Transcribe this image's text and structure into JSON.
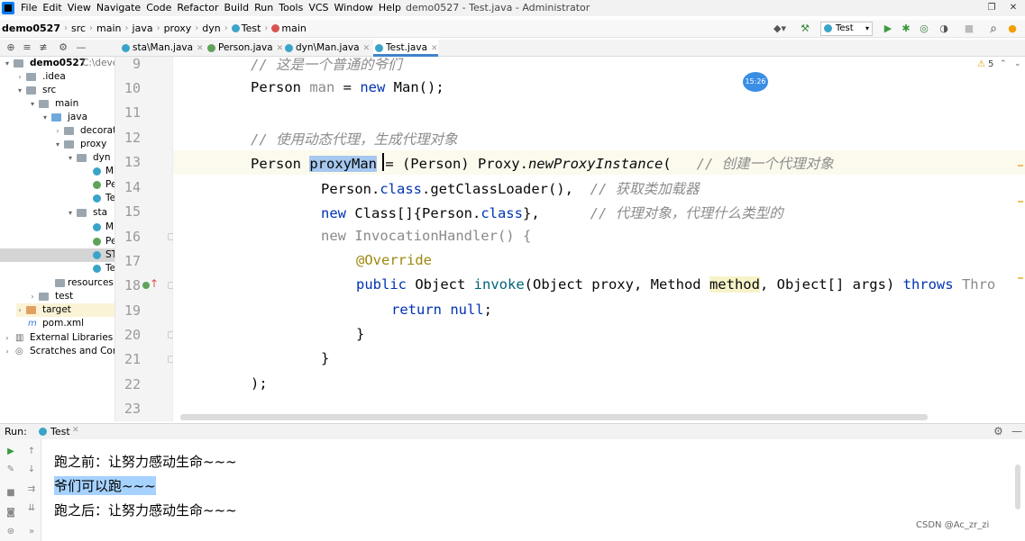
{
  "window": {
    "title": "demo0527 - Test.java - Administrator",
    "menus": [
      "File",
      "Edit",
      "View",
      "Navigate",
      "Code",
      "Refactor",
      "Build",
      "Run",
      "Tools",
      "VCS",
      "Window",
      "Help"
    ],
    "restore_glyph": "❐",
    "close_glyph": "✕"
  },
  "breadcrumb": [
    "demo0527",
    "src",
    "main",
    "java",
    "proxy",
    "dyn",
    "Test",
    "main"
  ],
  "toolbar": {
    "run_config": "Test",
    "warning_count": "5",
    "glyphs": {
      "build": "⚒",
      "run": "▶",
      "debug": "✱",
      "coverage": "◎",
      "profile": "◑",
      "stop": "■",
      "search": "⌕",
      "update": "●",
      "nav": "◆▾"
    }
  },
  "tabs": [
    {
      "label": "sta\\Man.java",
      "icon": "class"
    },
    {
      "label": "Person.java",
      "icon": "interface"
    },
    {
      "label": "dyn\\Man.java",
      "icon": "class"
    },
    {
      "label": "Test.java",
      "icon": "class",
      "active": true
    }
  ],
  "project_tools": [
    "⊕",
    "≡",
    "≢",
    "⚙",
    "—"
  ],
  "tree": [
    {
      "label": "demo0527",
      "path": "C:\\devel",
      "depth": 0,
      "arrow": "▾",
      "icon": "folder"
    },
    {
      "label": ".idea",
      "depth": 1,
      "arrow": "›",
      "icon": "folder"
    },
    {
      "label": "src",
      "depth": 1,
      "arrow": "▾",
      "icon": "folder"
    },
    {
      "label": "main",
      "depth": 2,
      "arrow": "▾",
      "icon": "folder"
    },
    {
      "label": "java",
      "depth": 3,
      "arrow": "▾",
      "icon": "folder-blue"
    },
    {
      "label": "decorato",
      "depth": 4,
      "arrow": "›",
      "icon": "folder"
    },
    {
      "label": "proxy",
      "depth": 4,
      "arrow": "▾",
      "icon": "folder"
    },
    {
      "label": "dyn",
      "depth": 5,
      "arrow": "▾",
      "icon": "folder"
    },
    {
      "label": "M",
      "depth": 6,
      "arrow": "",
      "icon": "class"
    },
    {
      "label": "Pe",
      "depth": 6,
      "arrow": "",
      "icon": "interface"
    },
    {
      "label": "Te",
      "depth": 6,
      "arrow": "",
      "icon": "class"
    },
    {
      "label": "sta",
      "depth": 5,
      "arrow": "▾",
      "icon": "folder"
    },
    {
      "label": "M",
      "depth": 6,
      "arrow": "",
      "icon": "class"
    },
    {
      "label": "Pe",
      "depth": 6,
      "arrow": "",
      "icon": "interface"
    },
    {
      "label": "ST",
      "depth": 6,
      "arrow": "",
      "icon": "class",
      "selected": true
    },
    {
      "label": "Te",
      "depth": 6,
      "arrow": "",
      "icon": "class"
    },
    {
      "label": "resources",
      "depth": 3,
      "arrow": "",
      "icon": "folder"
    },
    {
      "label": "test",
      "depth": 2,
      "arrow": "›",
      "icon": "folder"
    },
    {
      "label": "target",
      "depth": 1,
      "arrow": "›",
      "icon": "folder-orange"
    },
    {
      "label": "pom.xml",
      "depth": 1,
      "arrow": "",
      "icon": "xml"
    },
    {
      "label": "External Libraries",
      "depth": 0,
      "arrow": "›",
      "icon": "lib"
    },
    {
      "label": "Scratches and Console",
      "depth": 0,
      "arrow": "›",
      "icon": "scratch"
    }
  ],
  "line_numbers": [
    "9",
    "10",
    "11",
    "12",
    "13",
    "14",
    "15",
    "16",
    "17",
    "18",
    "19",
    "20",
    "21",
    "22",
    "23"
  ],
  "code": {
    "l9": "// 这是一个普通的爷们",
    "l10_a": "Person ",
    "l10_b": "man",
    "l10_c": " = ",
    "l10_d": "new",
    "l10_e": " Man();",
    "l12": "// 使用动态代理，生成代理对象",
    "l13_a": "Person ",
    "l13_b": "proxyMan",
    "l13_c": " = (Person) Proxy.",
    "l13_d": "newProxyInstance",
    "l13_e": "(   ",
    "l13_f": "// 创建一个代理对象",
    "l14_a": "Person.",
    "l14_b": "class",
    "l14_c": ".getClassLoader(),  ",
    "l14_d": "// 获取类加载器",
    "l15_a": "new",
    "l15_b": " Class[]{Person.",
    "l15_c": "class",
    "l15_d": "},      ",
    "l15_e": "// 代理对象，代理什么类型的",
    "l16_a": "new",
    "l16_b": " InvocationHandler() {",
    "l17": "@Override",
    "l18_a": "public",
    "l18_b": " Object ",
    "l18_c": "invoke",
    "l18_d": "(Object proxy, Method ",
    "l18_e": "method",
    "l18_f": ", Object[] args) ",
    "l18_g": "throws",
    "l18_h": " Thro",
    "l19_a": "return",
    "l19_b": " ",
    "l19_c": "null",
    "l19_d": ";",
    "l20": "}",
    "l21": "}",
    "l22": ");"
  },
  "badge": "15:26",
  "run": {
    "label": "Run:",
    "tab": "Test",
    "output": [
      "跑之前：让努力感动生命~~~",
      "爷们可以跑~~~",
      "跑之后：让努力感动生命~~~"
    ],
    "watermark": "CSDN @Ac_zr_zi"
  }
}
